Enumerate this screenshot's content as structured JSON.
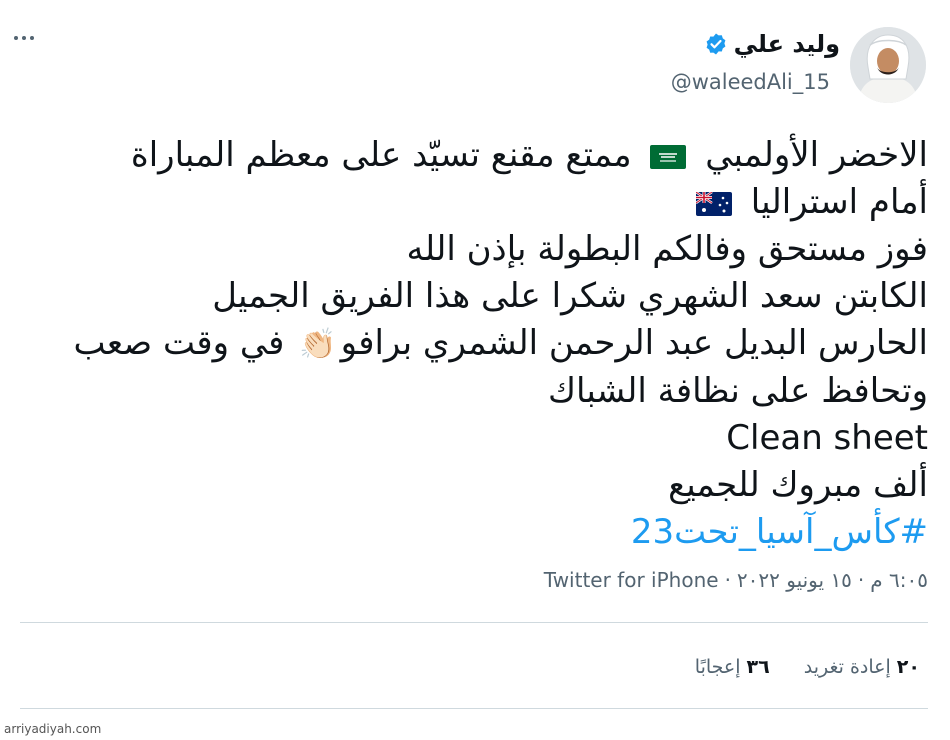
{
  "user": {
    "display_name": "وليد علي",
    "handle": "@waleedAli_15",
    "verified": true
  },
  "tweet": {
    "line1_pre": "الاخضر الأولمبي",
    "line1_post": "ممتع مقنع تسيّد على معظم المباراة",
    "line2": "أمام استراليا",
    "line3": "فوز مستحق وفالكم البطولة بإذن الله",
    "line4": "الكابتن سعد الشهري شكرا على هذا الفريق الجميل",
    "line5_pre": "الحارس البديل عبد الرحمن الشمري برافو",
    "line5_post": "في وقت صعب",
    "line6": "وتحافظ على نظافة الشباك",
    "line7": "Clean sheet",
    "line8": "ألف مبروك للجميع",
    "hashtag": "#كأس_آسيا_تحت23",
    "clap_emoji": "👏🏻",
    "flag_saudi": "saudi-flag",
    "flag_australia": "australia-flag"
  },
  "meta": {
    "time": "٦:٠٥ م",
    "date": "١٥ يونيو ٢٠٢٢",
    "separator": "·",
    "source": "Twitter for iPhone"
  },
  "stats": {
    "retweets_count": "٢٠",
    "retweets_label": "إعادة تغريد",
    "likes_count": "٣٦",
    "likes_label": "إعجابًا"
  },
  "watermark": "arriyadiyah.com",
  "colors": {
    "link": "#1d9bf0",
    "text": "#0f1419",
    "muted": "#536471",
    "verified": "#1d9bf0"
  }
}
